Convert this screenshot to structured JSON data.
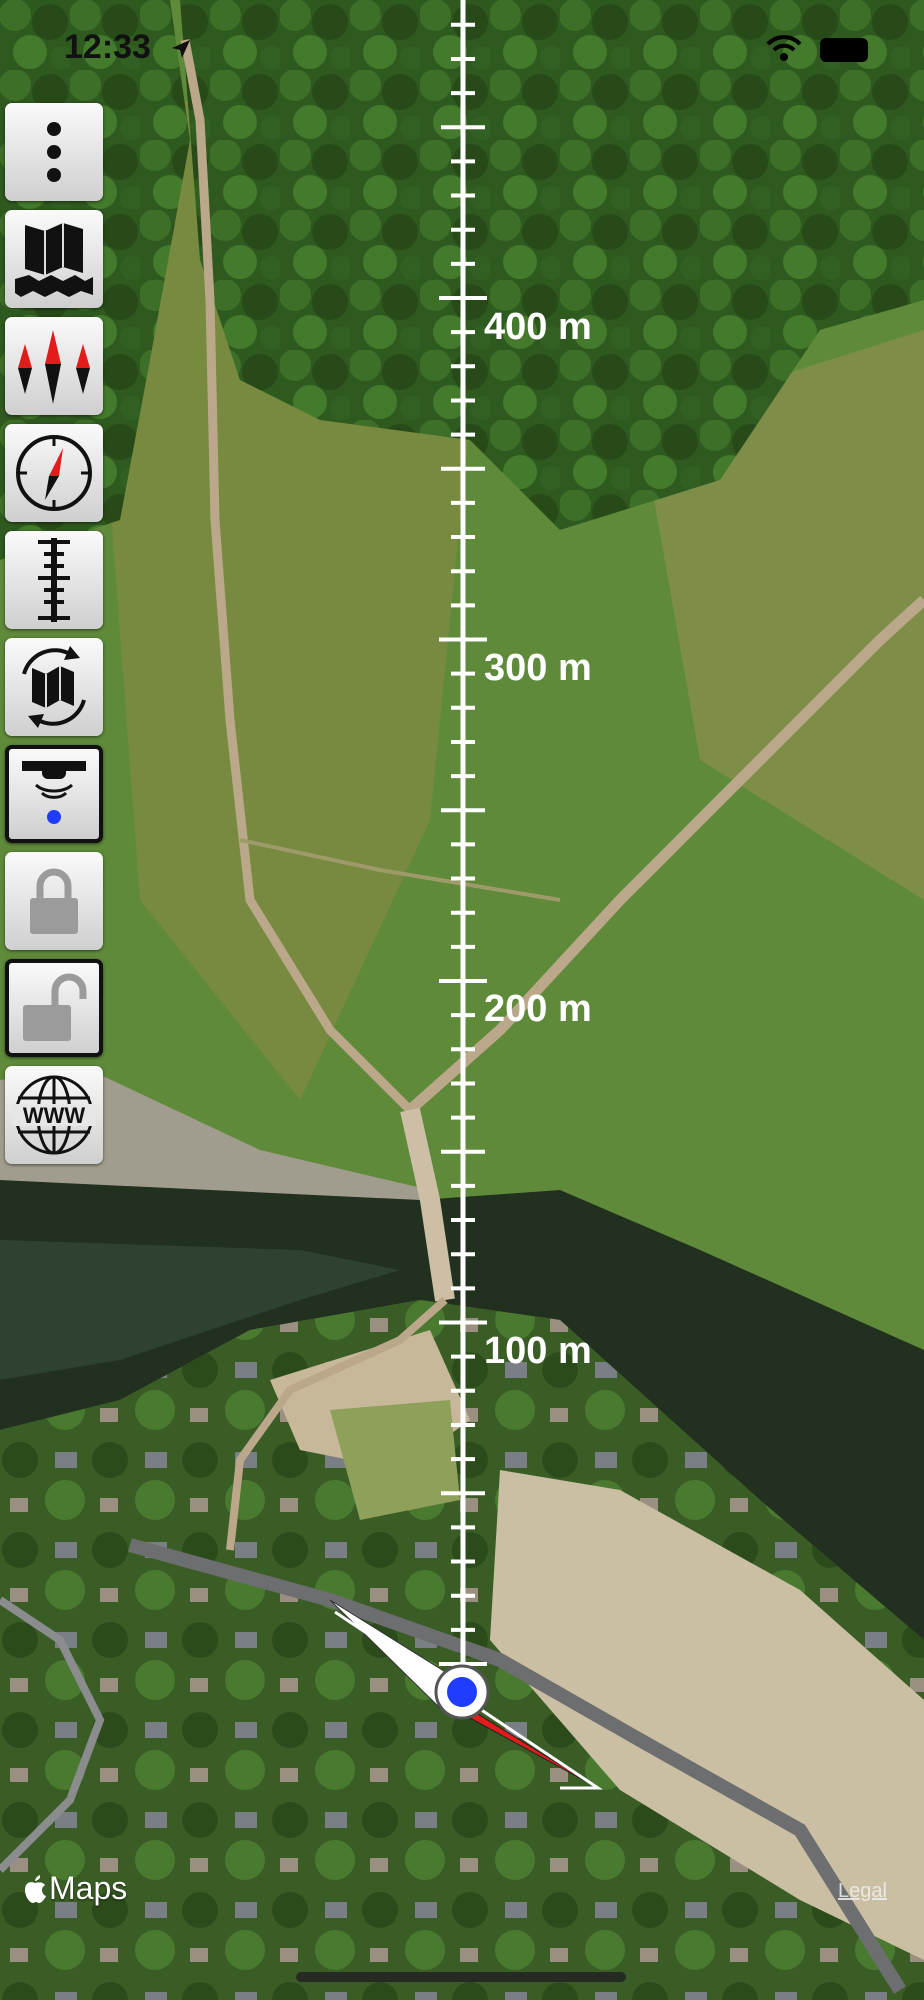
{
  "status_bar": {
    "time": "12:33",
    "location_icon": "location-arrow-icon",
    "wifi_icon": "wifi-icon",
    "battery_icon": "battery-icon"
  },
  "toolbar": {
    "buttons": [
      {
        "name": "menu-button",
        "icon": "vertical-dots-icon",
        "active": false
      },
      {
        "name": "map-type-button",
        "icon": "folded-map-icon",
        "active": false
      },
      {
        "name": "compass-needles-button",
        "icon": "compass-needles-icon",
        "active": false
      },
      {
        "name": "compass-button",
        "icon": "compass-icon",
        "active": false
      },
      {
        "name": "ruler-button",
        "icon": "ruler-icon",
        "active": false
      },
      {
        "name": "rotate-map-button",
        "icon": "rotate-map-icon",
        "active": false
      },
      {
        "name": "follow-location-button",
        "icon": "drone-location-icon",
        "active": true
      },
      {
        "name": "lock-button",
        "icon": "lock-closed-icon",
        "active": false
      },
      {
        "name": "unlock-button",
        "icon": "lock-open-icon",
        "active": true
      },
      {
        "name": "web-button",
        "icon": "www-globe-icon",
        "active": false
      }
    ]
  },
  "scale_bar": {
    "labels": [
      "400 m",
      "300 m",
      "200 m",
      "100 m"
    ]
  },
  "location": {
    "heading_marker_icon": "compass-needle-icon",
    "user_dot_icon": "user-location-dot-icon"
  },
  "attribution": {
    "maps_label": "Maps",
    "legal_label": "Legal"
  },
  "colors": {
    "accent_blue": "#1f3cff",
    "needle_red": "#e21b1b"
  }
}
